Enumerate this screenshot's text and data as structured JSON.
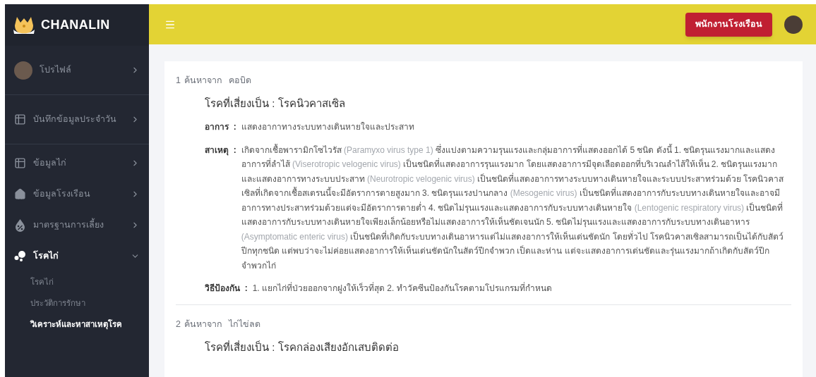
{
  "brand": {
    "name": "CHANALIN"
  },
  "header": {
    "role_button": "พนักงานโรงเรือน"
  },
  "sidebar": {
    "items": [
      {
        "kind": "avatar",
        "label": "โปรไฟล์",
        "expanded": false,
        "divider": true
      },
      {
        "kind": "table",
        "label": "บันทึกข้อมูลประจำวัน",
        "expanded": false,
        "divider": true
      },
      {
        "kind": "table",
        "label": "ข้อมูลไก่",
        "expanded": false,
        "divider": false
      },
      {
        "kind": "home",
        "label": "ข้อมูลโรงเรือน",
        "expanded": false,
        "divider": false
      },
      {
        "kind": "percent",
        "label": "มาตรฐานการเลี้ยง",
        "expanded": false,
        "divider": false
      },
      {
        "kind": "dots",
        "label": "โรคไก่",
        "expanded": true,
        "divider": false,
        "children": [
          {
            "label": "โรคไก่",
            "selected": false
          },
          {
            "label": "ประวัติการรักษา",
            "selected": false
          },
          {
            "label": "วิเคราะห์และหาสาเหตุโรค",
            "selected": true
          }
        ]
      }
    ]
  },
  "results": [
    {
      "index": "1",
      "search_label": "ค้นหาจาก",
      "keyword": "คอบิด",
      "disease_label": "โรคที่เสี่ยงเป็น :",
      "disease": "โรคนิวคาสเซิล",
      "fields": [
        {
          "label": "อาการ  :",
          "segments": [
            {
              "text": "แสดงอากาทางระบบทางเดินหายใจและประสาท",
              "muted": false
            }
          ]
        },
        {
          "label": "สาเหตุ  :",
          "segments": [
            {
              "text": "เกิดจากเชื้อพารามิกโซไวรัส ",
              "muted": false
            },
            {
              "text": "(Paramyxo virus type 1)",
              "muted": true
            },
            {
              "text": " ซึ่งแบ่งตามความรุนแรงและกลุ่มอาการที่แสดงออกได้ 5 ชนิด ดังนี้ 1. ชนิดรุนแรงมากและแสดงอาการที่ลำไส้ ",
              "muted": false
            },
            {
              "text": "(Viserotropic velogenic virus)",
              "muted": true
            },
            {
              "text": " เป็นชนิดที่แสดงอาการรุนแรงมาก โดยแสดงอาการมีจุดเลือดออกที่บริเวณลำไส้ให้เห็น 2. ชนิดรุนแรงมากและแสดงอาการทางระบบประสาท ",
              "muted": false
            },
            {
              "text": "(Neurotropic velogenic virus)",
              "muted": true
            },
            {
              "text": " เป็นชนิดที่แสดงอาการทางระบบทางเดินหายใจและระบบประสาทร่วมด้วย โรคนิวคาสเซิลที่เกิดจากเชื้อสเตรนนี้จะมีอัตราการตายสูงมาก 3. ชนิดรุนแรงปานกลาง ",
              "muted": false
            },
            {
              "text": "(Mesogenic virus)",
              "muted": true
            },
            {
              "text": " เป็นชนิดที่แสดงอาการกับระบบทางเดินหายใจและอาจมีอาการทางประสาทร่วมด้วยแต่จะมีอัตราการตายต่ำ 4. ชนิดไม่รุนแรงและแสดงอาการกับระบบทางเดินหายใจ ",
              "muted": false
            },
            {
              "text": "(Lentogenic respiratory virus)",
              "muted": true
            },
            {
              "text": " เป็นชนิดที่แสดงอาการกับระบบทางเดินหายใจเพียงเล็กน้อยหรือไม่แสดงอาการให้เห็นชัดเจนนัก 5. ชนิดไม่รุนแรงและแสดงอาการกับระบบทางเดินอาหาร ",
              "muted": false
            },
            {
              "text": "(Asymptomatic enteric virus)",
              "muted": true
            },
            {
              "text": " เป็นชนิดที่เกิดกับระบบทางเดินอาหารแต่ไม่แสดงอาการให้เห็นเด่นชัดนัก โดยทั่วไป โรคนิวคาสเซิลสามารถเป็นได้กับสัตว์ปีกทุกชนิด แต่พบว่าจะไม่ค่อยแสดงอาการให้เห็นเด่นชัดนักในสัตว์ปีกจำพวก เป็ดและห่าน แต่จะแสดงอาการเด่นชัดและรุ่นแรงมากถ้าเกิดกับสัตว์ปีกจำพวกไก่",
              "muted": false
            }
          ]
        },
        {
          "label": "วิธีป้องกัน  :",
          "segments": [
            {
              "text": "1. แยกไก่ที่ป่วยออกจากฝูงให้เร็วที่สุด 2. ทำวัคซีนป้องกันโรคตามโปรแกรมที่กำหนด",
              "muted": false
            }
          ]
        }
      ]
    },
    {
      "index": "2",
      "search_label": "ค้นหาจาก",
      "keyword": "ไก่ไข่ลด",
      "disease_label": "โรคที่เสี่ยงเป็น :",
      "disease": "โรคกล่องเสียงอักเสบติดต่อ"
    }
  ]
}
